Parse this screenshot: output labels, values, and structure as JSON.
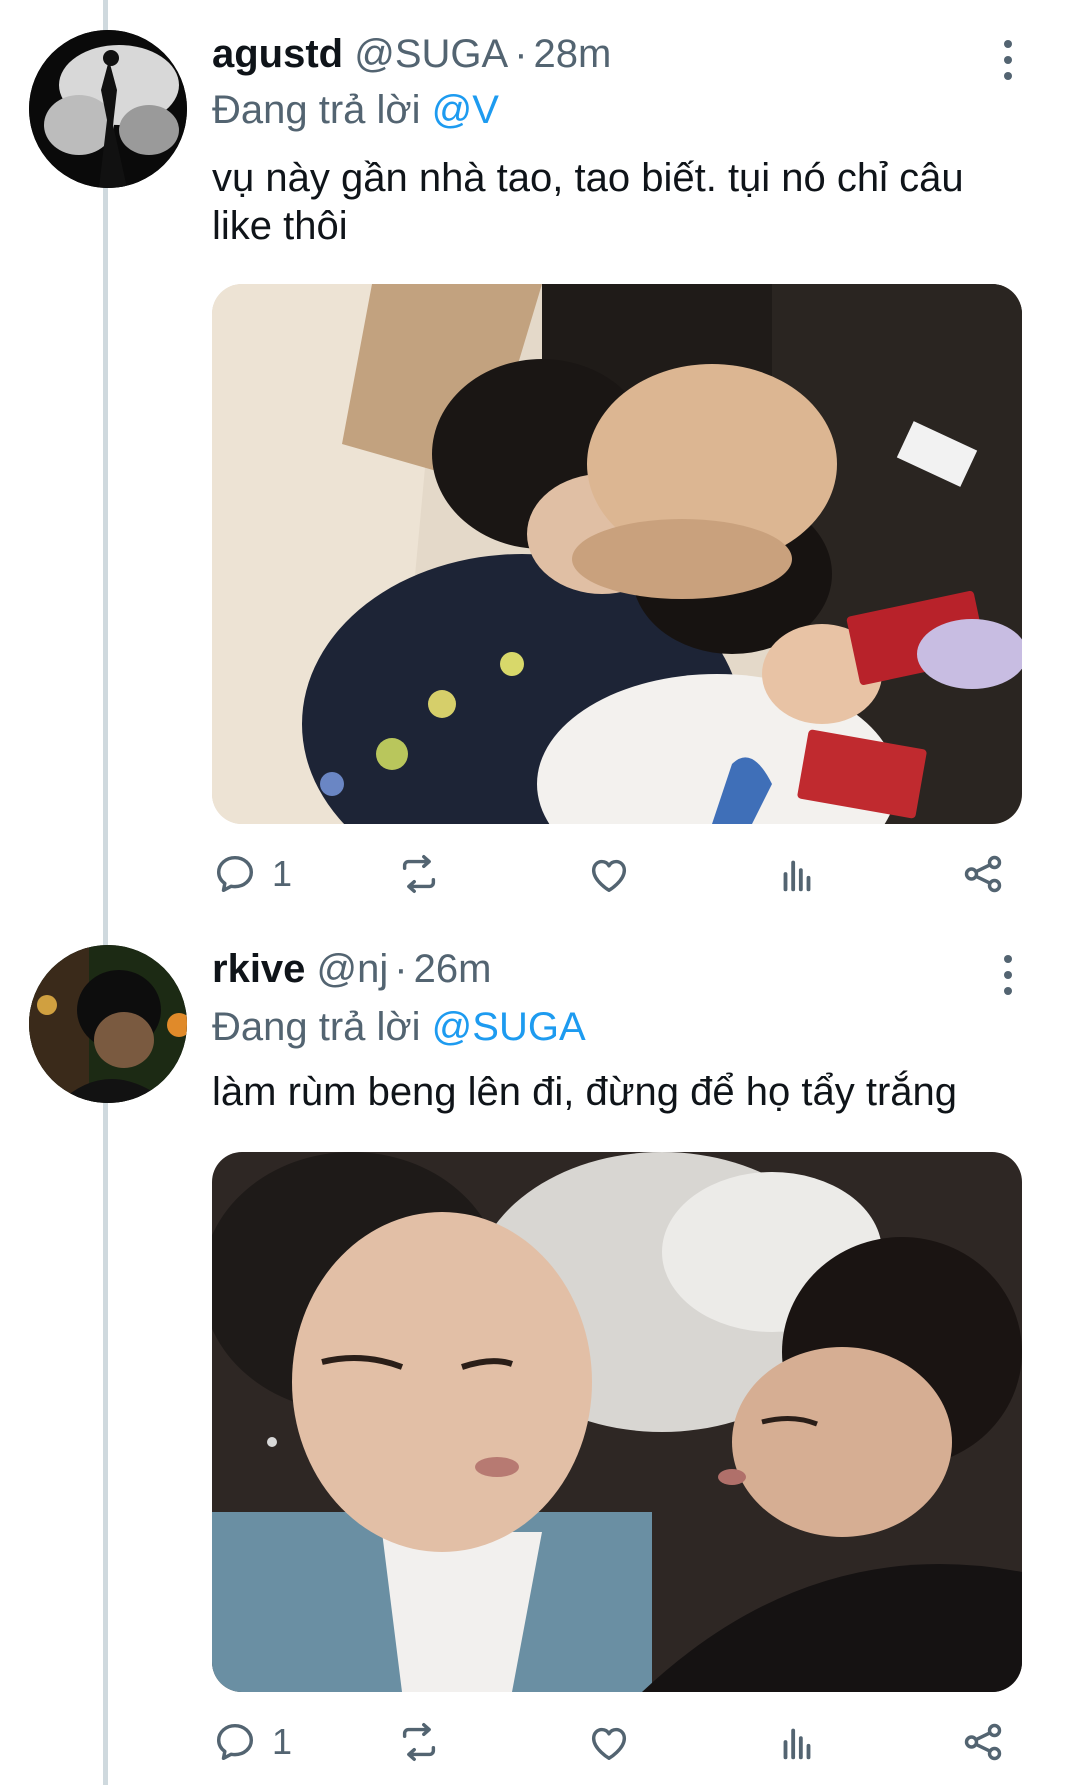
{
  "colors": {
    "accent": "#1d9bf0",
    "secondary_text": "#536471",
    "thread_line": "#cfd9de"
  },
  "tweets": [
    {
      "name": "agustd",
      "handle": "@SUGA",
      "separator": "·",
      "time": "28m",
      "reply_prefix": "Đang trả lời",
      "reply_to": "@V",
      "text": "vụ này gần nhà tao, tao biết. tụi nó chỉ câu like thôi",
      "reply_count": "1",
      "icons": [
        "reply-icon",
        "retweet-icon",
        "like-icon",
        "analytics-icon",
        "share-icon",
        "more-icon"
      ]
    },
    {
      "name": "rkive",
      "handle": "@nj",
      "separator": "·",
      "time": "26m",
      "reply_prefix": "Đang trả lời",
      "reply_to": "@SUGA",
      "text": "làm rùm beng lên đi, đừng để họ tẩy trắng",
      "reply_count": "1",
      "icons": [
        "reply-icon",
        "retweet-icon",
        "like-icon",
        "analytics-icon",
        "share-icon",
        "more-icon"
      ]
    }
  ]
}
